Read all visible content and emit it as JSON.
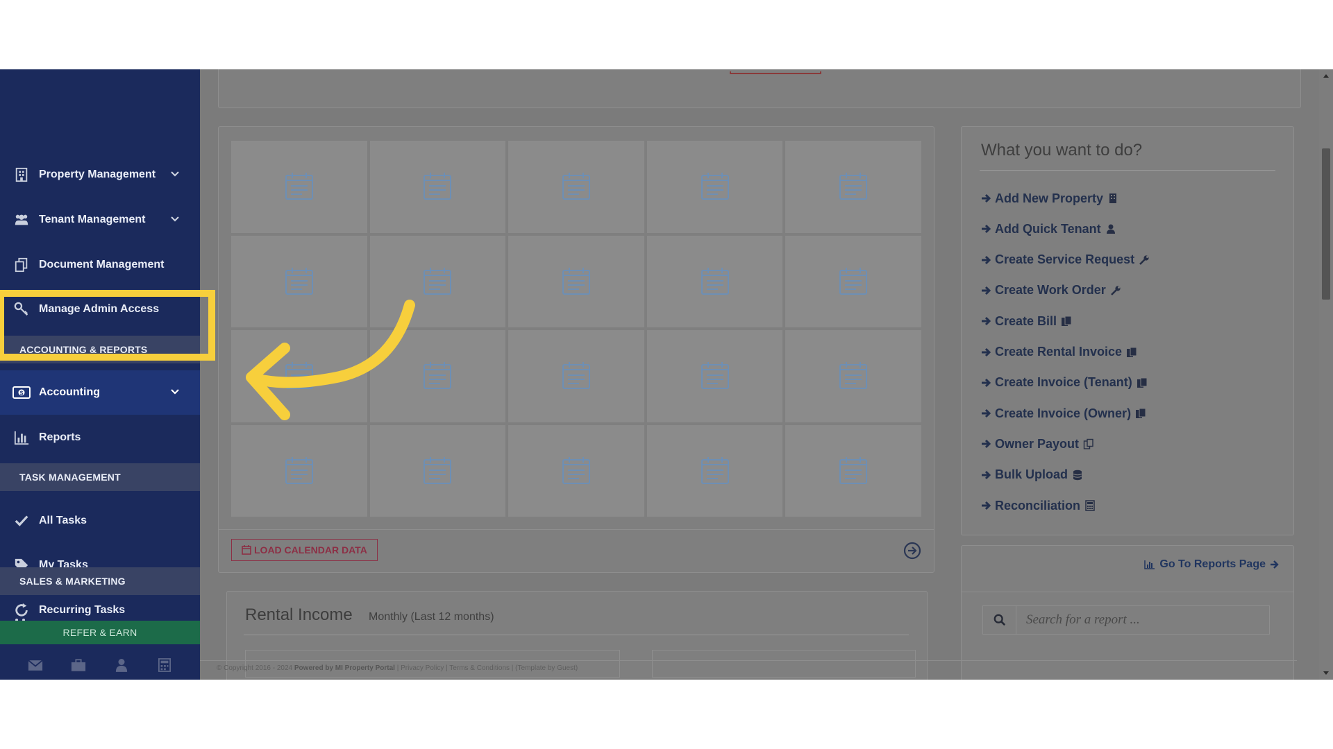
{
  "sidebar": {
    "items_top": [
      {
        "label": "Property Management",
        "icon": "building-icon",
        "has_chevron": true
      },
      {
        "label": "Tenant Management",
        "icon": "users-icon",
        "has_chevron": true
      },
      {
        "label": "Document Management",
        "icon": "documents-icon",
        "has_chevron": false
      },
      {
        "label": "Manage Admin Access",
        "icon": "key-icon",
        "has_chevron": false
      }
    ],
    "section_accounting": "ACCOUNTING & REPORTS",
    "accounting_label": "Accounting",
    "reports_label": "Reports",
    "section_tasks": "TASK MANAGEMENT",
    "tasks": [
      {
        "label": "All Tasks",
        "icon": "check-icon"
      },
      {
        "label": "My Tasks",
        "icon": "tag-icon"
      },
      {
        "label": "Recurring Tasks",
        "icon": "refresh-icon"
      }
    ],
    "section_sales": "SALES & MARKETING",
    "refer_label": "REFER & EARN",
    "bottom_icons": [
      "mail-icon",
      "briefcase-icon",
      "user-icon",
      "calculator-icon"
    ]
  },
  "calendar": {
    "rows": 4,
    "cols": 5,
    "load_button_label": "LOAD CALENDAR DATA"
  },
  "rental_income": {
    "title": "Rental Income",
    "subtitle": "Monthly (Last 12 months)"
  },
  "todo": {
    "title": "What you want to do?",
    "items": [
      {
        "label": "Add New Property",
        "icon": "building-icon"
      },
      {
        "label": "Add Quick Tenant",
        "icon": "user-icon"
      },
      {
        "label": "Create Service Request",
        "icon": "wrench-icon"
      },
      {
        "label": "Create Work Order",
        "icon": "wrench-icon"
      },
      {
        "label": "Create Bill",
        "icon": "copy-icon"
      },
      {
        "label": "Create Rental Invoice",
        "icon": "copy-icon"
      },
      {
        "label": "Create Invoice (Tenant)",
        "icon": "copy-icon"
      },
      {
        "label": "Create Invoice (Owner)",
        "icon": "copy-icon"
      },
      {
        "label": "Owner Payout",
        "icon": "copy-outline-icon"
      },
      {
        "label": "Bulk Upload",
        "icon": "database-icon"
      },
      {
        "label": "Reconciliation",
        "icon": "calculator-icon"
      }
    ]
  },
  "reports": {
    "go_label": "Go To Reports Page",
    "search_placeholder": "Search for a report ..."
  },
  "footer": {
    "copyright": "© Copyright 2016 - 2024",
    "powered": "Powered by MI Property Portal",
    "links": "| Privacy Policy | Terms & Conditions |",
    "template": "(Template by Guest)"
  },
  "colors": {
    "sidebar_bg": "#1b2a5c",
    "highlight": "#f7cf3c",
    "overlay": "#7b7b7b",
    "refer_bg": "#1c6b49"
  }
}
